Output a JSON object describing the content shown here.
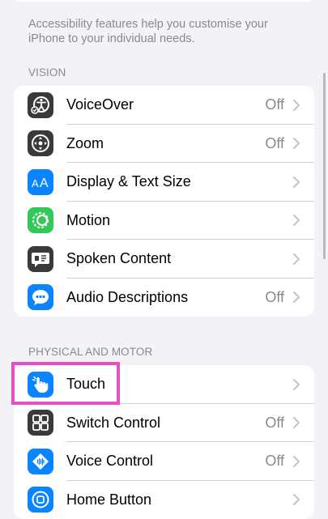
{
  "intro": {
    "text": "Accessibility features help you customise your iPhone to your individual needs."
  },
  "vision": {
    "header": "VISION",
    "items": [
      {
        "label": "VoiceOver",
        "value": "Off",
        "icon": "voiceover-icon",
        "color": "#3a3a3c"
      },
      {
        "label": "Zoom",
        "value": "Off",
        "icon": "zoom-icon",
        "color": "#3a3a3c"
      },
      {
        "label": "Display & Text Size",
        "value": "",
        "icon": "display-text-size-icon",
        "color": "#0a84ff"
      },
      {
        "label": "Motion",
        "value": "",
        "icon": "motion-icon",
        "color": "#34c759"
      },
      {
        "label": "Spoken Content",
        "value": "",
        "icon": "spoken-content-icon",
        "color": "#3a3a3c"
      },
      {
        "label": "Audio Descriptions",
        "value": "Off",
        "icon": "audio-descriptions-icon",
        "color": "#0a84ff"
      }
    ]
  },
  "physical": {
    "header": "PHYSICAL AND MOTOR",
    "items": [
      {
        "label": "Touch",
        "value": "",
        "icon": "touch-hand-icon",
        "color": "#0a84ff"
      },
      {
        "label": "Switch Control",
        "value": "Off",
        "icon": "switch-control-icon",
        "color": "#3a3a3c"
      },
      {
        "label": "Voice Control",
        "value": "Off",
        "icon": "voice-control-icon",
        "color": "#0a84ff"
      },
      {
        "label": "Home Button",
        "value": "",
        "icon": "home-button-icon",
        "color": "#0a84ff"
      }
    ]
  },
  "highlight_color": "#e84fc6"
}
